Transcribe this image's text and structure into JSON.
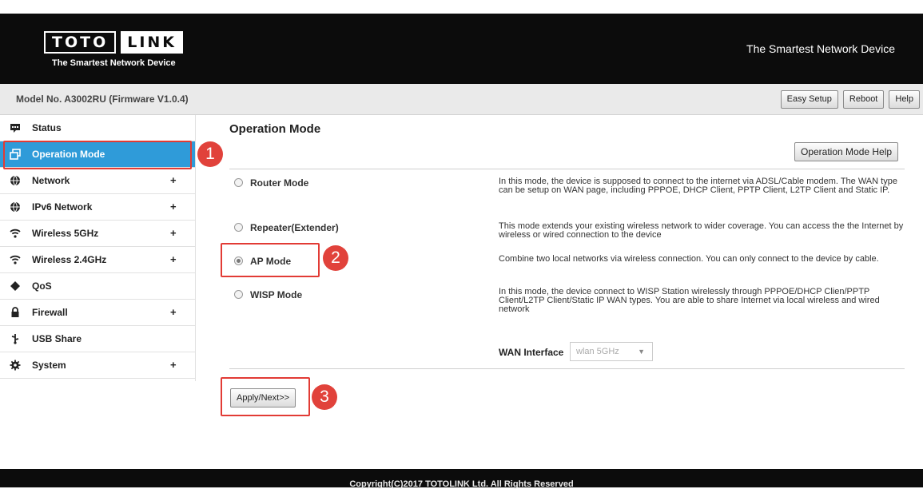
{
  "header": {
    "logo_left": "TOTO",
    "logo_right": "LINK",
    "logo_tagline": "The Smartest Network Device",
    "slogan": "The Smartest Network Device"
  },
  "model_bar": {
    "model_text": "Model No. A3002RU (Firmware V1.0.4)",
    "buttons": [
      "Easy Setup",
      "Reboot",
      "Help"
    ]
  },
  "sidebar": {
    "items": [
      {
        "label": "Status",
        "icon": "status-icon",
        "expandable": false,
        "active": false
      },
      {
        "label": "Operation Mode",
        "icon": "operation-mode-icon",
        "expandable": false,
        "active": true
      },
      {
        "label": "Network",
        "icon": "globe-icon",
        "expandable": true,
        "active": false
      },
      {
        "label": "IPv6 Network",
        "icon": "globe-icon",
        "expandable": true,
        "active": false
      },
      {
        "label": "Wireless 5GHz",
        "icon": "wifi-icon",
        "expandable": true,
        "active": false
      },
      {
        "label": "Wireless 2.4GHz",
        "icon": "wifi-icon",
        "expandable": true,
        "active": false
      },
      {
        "label": "QoS",
        "icon": "qos-icon",
        "expandable": false,
        "active": false
      },
      {
        "label": "Firewall",
        "icon": "lock-icon",
        "expandable": true,
        "active": false
      },
      {
        "label": "USB Share",
        "icon": "usb-icon",
        "expandable": false,
        "active": false
      },
      {
        "label": "System",
        "icon": "gear-icon",
        "expandable": true,
        "active": false
      }
    ],
    "expand_symbol": "+"
  },
  "main": {
    "title": "Operation Mode",
    "help_button": "Operation Mode Help",
    "modes": [
      {
        "label": "Router Mode",
        "selected": false,
        "description": "In this mode, the device is supposed to connect to the internet via ADSL/Cable modem. The WAN type can be setup on WAN page, including PPPOE, DHCP Client, PPTP Client, L2TP Client and Static IP."
      },
      {
        "label": "Repeater(Extender)",
        "selected": false,
        "description": "This mode extends your existing wireless network to wider coverage. You can access the the Internet by wireless or wired connection to the device"
      },
      {
        "label": "AP Mode",
        "selected": true,
        "description": "Combine two local networks via wireless connection. You can only connect to the device by cable."
      },
      {
        "label": "WISP Mode",
        "selected": false,
        "description": "In this mode, the device connect to WISP Station wirelessly through PPPOE/DHCP Clien/PPTP Client/L2TP Client/Static IP WAN types. You are able to share Internet via local wireless and wired network"
      }
    ],
    "wan_interface_label": "WAN Interface",
    "wan_interface_value": "wlan 5GHz",
    "wan_caret": "▼",
    "apply_button": "Apply/Next>>"
  },
  "annotations": {
    "badges": [
      "1",
      "2",
      "3"
    ],
    "color": "#e1423b"
  },
  "footer": {
    "text": "Copyright(C)2017 TOTOLINK Ltd. All Rights Reserved"
  },
  "colors": {
    "header_bg": "#0c0c0c",
    "active_nav": "#2f9bd9",
    "callout_red": "#e23b35"
  }
}
